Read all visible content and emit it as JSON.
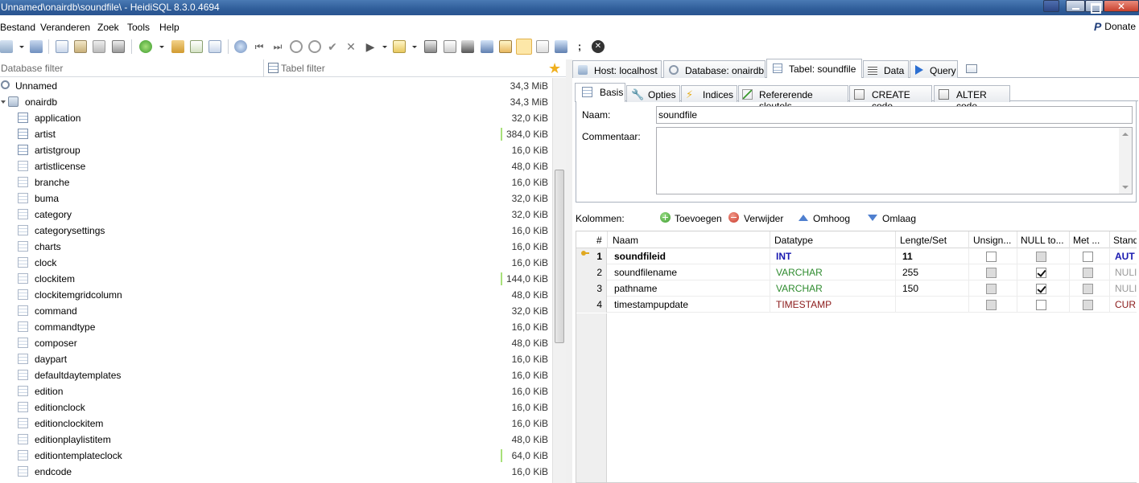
{
  "window": {
    "title": "Unnamed\\onairdb\\soundfile\\ - HeidiSQL 8.3.0.4694"
  },
  "menu": {
    "items": [
      "Bestand",
      "Veranderen",
      "Zoek",
      "Tools",
      "Help"
    ],
    "donate": "Donate"
  },
  "filters": {
    "database_placeholder": "Database filter",
    "table_placeholder": "Tabel filter"
  },
  "tree": {
    "server": {
      "name": "Unnamed",
      "size": "34,3 MiB"
    },
    "database": {
      "name": "onairdb",
      "size": "34,3 MiB"
    },
    "tables": [
      {
        "name": "application",
        "size": "32,0 KiB",
        "bar": false
      },
      {
        "name": "artist",
        "size": "384,0 KiB",
        "bar": true
      },
      {
        "name": "artistgroup",
        "size": "16,0 KiB",
        "bar": false
      },
      {
        "name": "artistlicense",
        "size": "48,0 KiB",
        "bar": false
      },
      {
        "name": "branche",
        "size": "16,0 KiB",
        "bar": false
      },
      {
        "name": "buma",
        "size": "32,0 KiB",
        "bar": false
      },
      {
        "name": "category",
        "size": "32,0 KiB",
        "bar": false
      },
      {
        "name": "categorysettings",
        "size": "16,0 KiB",
        "bar": false
      },
      {
        "name": "charts",
        "size": "16,0 KiB",
        "bar": false
      },
      {
        "name": "clock",
        "size": "16,0 KiB",
        "bar": false
      },
      {
        "name": "clockitem",
        "size": "144,0 KiB",
        "bar": true
      },
      {
        "name": "clockitemgridcolumn",
        "size": "48,0 KiB",
        "bar": false
      },
      {
        "name": "command",
        "size": "32,0 KiB",
        "bar": false
      },
      {
        "name": "commandtype",
        "size": "16,0 KiB",
        "bar": false
      },
      {
        "name": "composer",
        "size": "48,0 KiB",
        "bar": false
      },
      {
        "name": "daypart",
        "size": "16,0 KiB",
        "bar": false
      },
      {
        "name": "defaultdaytemplates",
        "size": "16,0 KiB",
        "bar": false
      },
      {
        "name": "edition",
        "size": "16,0 KiB",
        "bar": false
      },
      {
        "name": "editionclock",
        "size": "16,0 KiB",
        "bar": false
      },
      {
        "name": "editionclockitem",
        "size": "16,0 KiB",
        "bar": false
      },
      {
        "name": "editionplaylistitem",
        "size": "48,0 KiB",
        "bar": false
      },
      {
        "name": "editiontemplateclock",
        "size": "64,0 KiB",
        "bar": true
      },
      {
        "name": "endcode",
        "size": "16,0 KiB",
        "bar": false
      }
    ]
  },
  "main_tabs": [
    "Host: localhost",
    "Database: onairdb",
    "Tabel: soundfile",
    "Data",
    "Query"
  ],
  "sub_tabs": [
    "Basis",
    "Opties",
    "Indices",
    "Refererende sleutels",
    "CREATE code",
    "ALTER code"
  ],
  "basis": {
    "name_label": "Naam:",
    "name_value": "soundfile",
    "comment_label": "Commentaar:"
  },
  "columns_toolbar": {
    "label": "Kolommen:",
    "add": "Toevoegen",
    "remove": "Verwijder",
    "up": "Omhoog",
    "down": "Omlaag"
  },
  "grid": {
    "headers": [
      "#",
      "Naam",
      "Datatype",
      "Lengte/Set",
      "Unsign...",
      "NULL to...",
      "Met ...",
      "Stand"
    ],
    "rows": [
      {
        "num": "1",
        "name": "soundfileid",
        "type": "INT",
        "length": "11",
        "unsigned": false,
        "unsigned_gray": false,
        "null": false,
        "null_gray": true,
        "zerofill": false,
        "zerofill_gray": false,
        "default": "AUT",
        "primary": true
      },
      {
        "num": "2",
        "name": "soundfilename",
        "type": "VARCHAR",
        "length": "255",
        "unsigned": false,
        "unsigned_gray": true,
        "null": true,
        "null_gray": false,
        "zerofill": false,
        "zerofill_gray": true,
        "default": "NULI",
        "primary": false
      },
      {
        "num": "3",
        "name": "pathname",
        "type": "VARCHAR",
        "length": "150",
        "unsigned": false,
        "unsigned_gray": true,
        "null": true,
        "null_gray": false,
        "zerofill": false,
        "zerofill_gray": true,
        "default": "NULI",
        "primary": false
      },
      {
        "num": "4",
        "name": "timestampupdate",
        "type": "TIMESTAMP",
        "length": "",
        "unsigned": false,
        "unsigned_gray": true,
        "null": false,
        "null_gray": false,
        "zerofill": false,
        "zerofill_gray": true,
        "default": "CURI",
        "primary": false
      }
    ]
  },
  "colors": {
    "int": "#1a1ab0",
    "varchar": "#2e8b2e",
    "timestamp": "#8b1a1a",
    "default_auto": "#1a1ab0",
    "default_null": "#9a9a9a",
    "default_cur": "#8b1a1a",
    "size_bar": "#a8e07a"
  }
}
